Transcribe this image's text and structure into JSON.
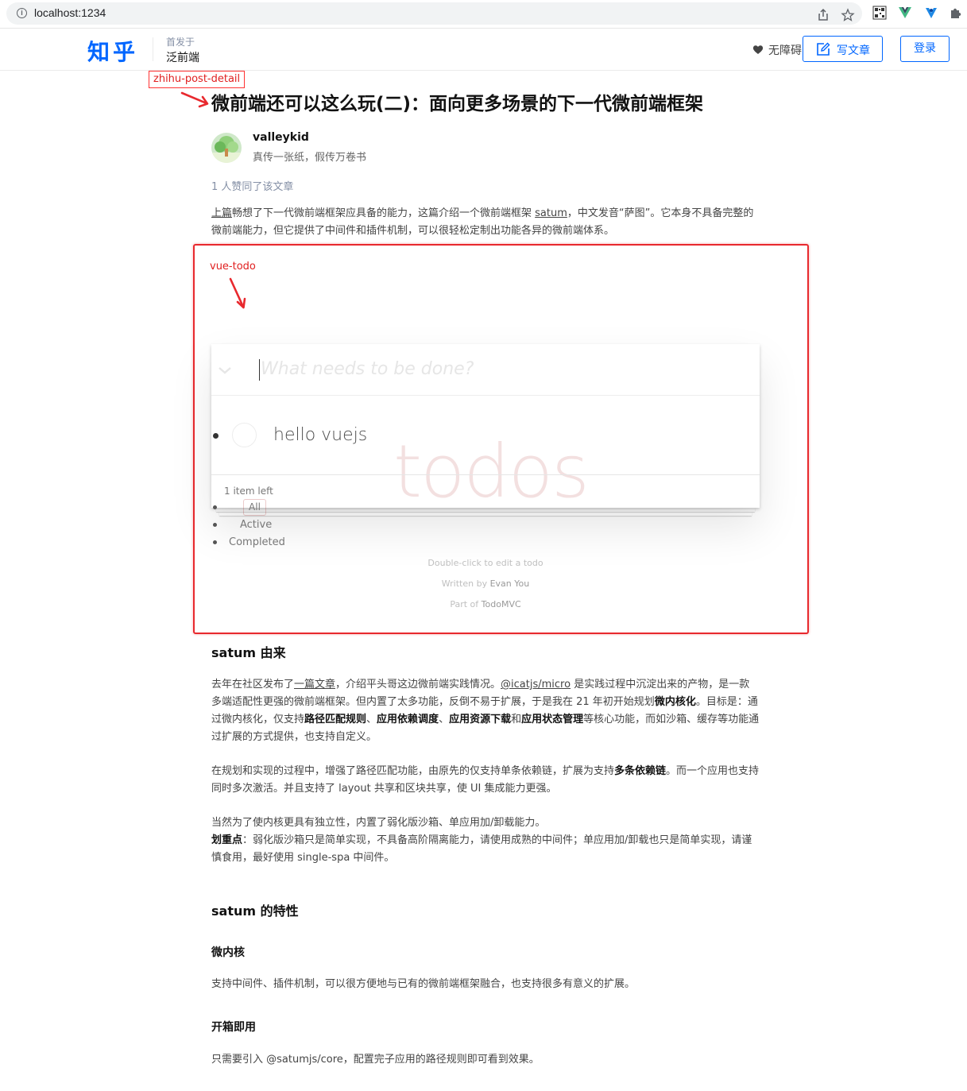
{
  "browser": {
    "url": "localhost:1234",
    "info_icon": "info-icon",
    "share_icon": "share-icon",
    "star_icon": "star-icon",
    "qr_icon": "qr-code-icon",
    "vue_icon": "vue-devtools-icon",
    "ext_icon": "extension-icon",
    "puzzle_icon": "puzzle-icon"
  },
  "header": {
    "logo": "知乎",
    "first_published_label": "首发于",
    "column_name": "泛前端",
    "accessibility": "无障碍",
    "write_article": "写文章",
    "login": "登录"
  },
  "annotations": {
    "post_detail_label": "zhihu-post-detail",
    "vue_todo_label": "vue-todo"
  },
  "post": {
    "title": "微前端还可以这么玩(二)：面向更多场景的下一代微前端框架",
    "author_name": "valleykid",
    "author_bio": "真传一张纸，假传万卷书",
    "votes": "1 人赞同了该文章",
    "intro": {
      "link_prev": "上篇",
      "text1": "畅想了下一代微前端框架应具备的能力，这篇介绍一个微前端框架 ",
      "link_satum": "satum",
      "text2": "，中文发音“萨图”。它本身不具备完整的微前端能力，但它提供了中间件和插件机制，可以很轻松定制出功能各异的微前端体系。"
    },
    "section_origin_title": "satum 由来",
    "origin_p1": {
      "t1": "去年在社区发布了",
      "link_article": "一篇文章",
      "t2": "，介绍平头哥这边微前端实践情况。",
      "link_micro": "@icatjs/micro",
      "t3": " 是实践过程中沉淀出来的产物，是一款多端适配性更强的微前端框架。但内置了太多功能，反倒不易于扩展，于是我在 21 年初开始规划",
      "b1": "微内核化",
      "t4": "。目标是：通过微内核化，仅支持",
      "b2": "路径匹配规则",
      "t5": "、",
      "b3": "应用依赖调度",
      "t6": "、",
      "b4": "应用资源下载",
      "t7": "和",
      "b5": "应用状态管理",
      "t8": "等核心功能，而如沙箱、缓存等功能通过扩展的方式提供，也支持自定义。"
    },
    "origin_p2": {
      "t1": "在规划和实现的过程中，增强了路径匹配功能，由原先的仅支持单条依赖链，扩展为支持",
      "b1": "多条依赖链",
      "t2": "。而一个应用也支持同时多次激活。并且支持了 layout 共享和区块共享，使 UI 集成能力更强。"
    },
    "origin_p3": {
      "t1": "当然为了使内核更具有独立性，内置了弱化版沙箱、单应用加/卸载能力。",
      "b1": "划重点",
      "t2": "：弱化版沙箱只是简单实现，不具备高阶隔离能力，请使用成熟的中间件；单应用加/卸载也只是简单实现，请谨慎食用，最好使用 single-spa 中间件。"
    },
    "section_features_title": "satum 的特性",
    "feature1_title": "微内核",
    "feature1_text": "支持中间件、插件机制，可以很方便地与已有的微前端框架融合，也支持很多有意义的扩展。",
    "feature2_title": "开箱即用",
    "feature2_text": "只需要引入 @satumjs/core，配置完子应用的路径规则即可看到效果。"
  },
  "todo": {
    "watermark": "todos",
    "placeholder": "What needs to be done?",
    "items": [
      {
        "title": "hello vuejs",
        "completed": false
      }
    ],
    "items_left": "1 item left",
    "filters": [
      "All",
      "Active",
      "Completed"
    ],
    "selected_filter": "All",
    "info_edit": "Double-click to edit a todo",
    "info_written_prefix": "Written by ",
    "info_written_author": "Evan You",
    "info_part_prefix": "Part of ",
    "info_part_link": "TodoMVC"
  },
  "colors": {
    "zhihu_blue": "#0066ff",
    "annotation_red": "#e8292e",
    "todo_watermark": "#af2f2f"
  }
}
